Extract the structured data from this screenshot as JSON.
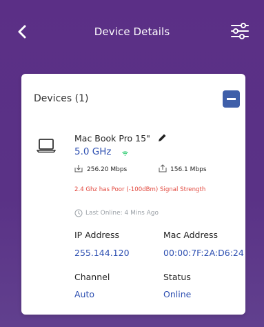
{
  "header": {
    "title": "Device Details"
  },
  "card": {
    "devices_label": "Devices (1)",
    "device": {
      "name": "Mac Book Pro 15\"",
      "band": "5.0 GHz",
      "download_speed": "256.20 Mbps",
      "upload_speed": "156.1 Mbps",
      "warning": "2.4 Ghz has Poor (-100dBm) Signal Strength",
      "last_online": "Last Online: 4 Mins Ago"
    },
    "details": {
      "ip_label": "IP Address",
      "ip_value": "255.144.120",
      "mac_label": "Mac Address",
      "mac_value": "00:00:7F:2A:D6:24",
      "channel_label": "Channel",
      "channel_value": "Auto",
      "status_label": "Status",
      "status_value": "Online"
    }
  },
  "colors": {
    "header_bg": "#5b2f86",
    "accent_blue": "#2d4fb1",
    "button_blue": "#3f5fa9",
    "warning_red": "#e2493f",
    "wifi_green": "#2ecc71",
    "muted_gray": "#9aa0a6"
  },
  "icons": {
    "back": "chevron-left-icon",
    "settings": "sliders-icon",
    "collapse": "minus-icon",
    "device": "laptop-icon",
    "edit": "pencil-icon",
    "signal": "wifi-icon",
    "download": "download-icon",
    "upload": "upload-icon",
    "time": "clock-icon"
  }
}
